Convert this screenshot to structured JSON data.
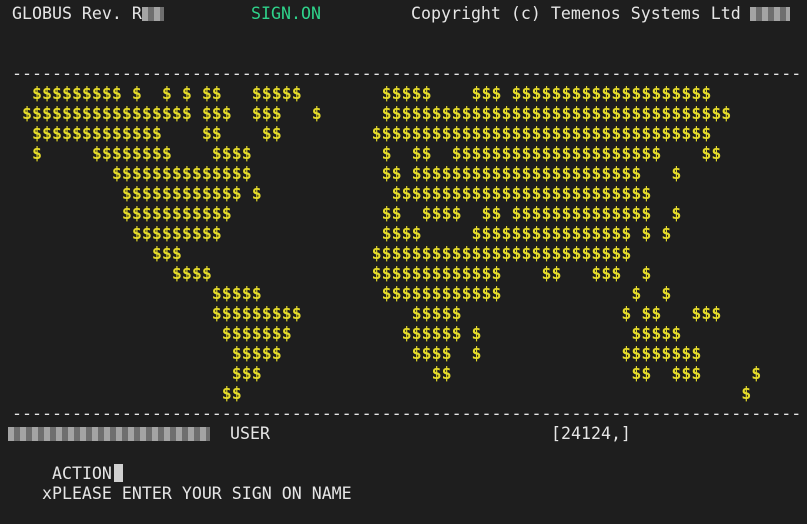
{
  "header": {
    "product": "GLOBUS Rev. R",
    "mode": "SIGN.ON",
    "copyright": "Copyright (c) Temenos Systems Ltd"
  },
  "rule": "-------------------------------------------------------------------------------",
  "map": {
    "rows": [
      "  $$$$$$$$$ $  $ $ $$   $$$$$        $$$$$    $$$ $$$$$$$$$$$$$$$$$$$$",
      " $$$$$$$$$$$$$$$$$ $$$  $$$   $      $$$$$$$$$$$$$$$$$$$$$$$$$$$$$$$$$$$",
      "  $$$$$$$$$$$$$    $$    $$         $$$$$$$$$$$$$$$$$$$$$$$$$$$$$$$$$$",
      "  $     $$$$$$$$    $$$$             $  $$  $$$$$$$$$$$$$$$$$$$$$    $$",
      "          $$$$$$$$$$$$$$             $$ $$$$$$$$$$$$$$$$$$$$$$$   $",
      "           $$$$$$$$$$$$ $             $$$$$$$$$$$$$$$$$$$$$$$$$$",
      "           $$$$$$$$$$$               $$  $$$$  $$ $$$$$$$$$$$$$$  $",
      "            $$$$$$$$$                $$$$     $$$$$$$$$$$$$$$$ $ $",
      "              $$$                   $$$$$$$$$$$$$$$$$$$$$$$$$$",
      "                $$$$                $$$$$$$$$$$$$    $$   $$$  $",
      "                    $$$$$            $$$$$$$$$$$$             $  $",
      "                    $$$$$$$$$           $$$$$                $ $$   $$$",
      "                     $$$$$$$           $$$$$$ $               $$$$$",
      "                      $$$$$             $$$$  $              $$$$$$$$",
      "                      $$$                 $$                  $$  $$$     $",
      "                     $$                                                  $"
    ]
  },
  "footer": {
    "user_label": "USER",
    "session_id": "[24124,]",
    "action_label": "ACTION",
    "prompt": "xPLEASE ENTER YOUR SIGN ON NAME"
  }
}
